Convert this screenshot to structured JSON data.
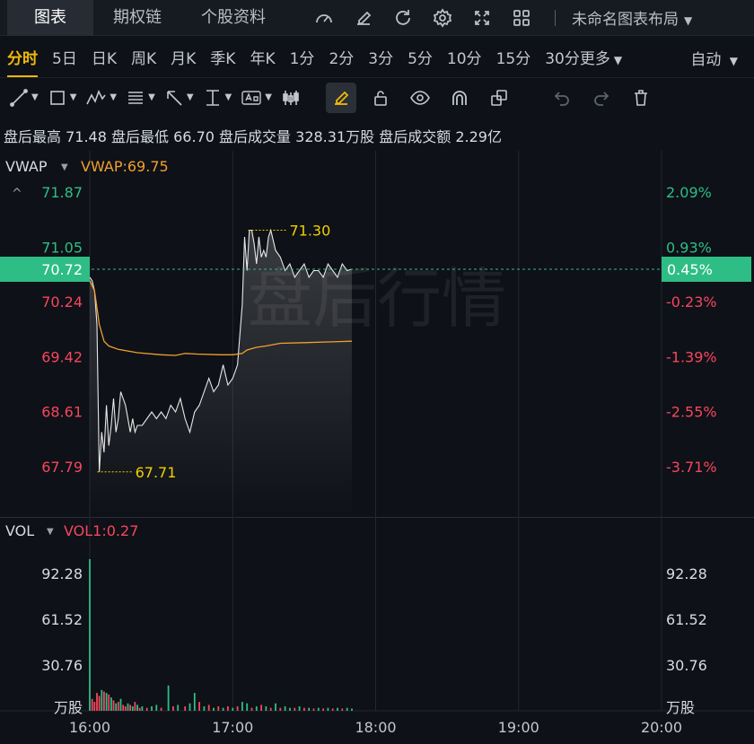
{
  "tabs": [
    "图表",
    "期权链",
    "个股资料"
  ],
  "layout_name": "未命名图表布局",
  "topbar_icons": [
    "gauge-icon",
    "edit-icon",
    "refresh-icon",
    "settings-icon",
    "fullscreen-icon",
    "grid-icon"
  ],
  "periods": [
    "分时",
    "5日",
    "日K",
    "周K",
    "月K",
    "季K",
    "年K",
    "1分",
    "2分",
    "3分",
    "5分",
    "10分",
    "15分",
    "30分更多"
  ],
  "active_period": "分时",
  "auto_label": "自动",
  "tools": [
    "line-tool-icon",
    "rect-tool-icon",
    "pattern-tool-icon",
    "fib-tool-icon",
    "arrow-tool-icon",
    "measure-tool-icon",
    "text-tool-icon",
    "candle-tool-icon",
    "pencil-icon",
    "unlock-icon",
    "eye-icon",
    "magnet-icon",
    "copy-icon",
    "undo-icon",
    "redo-icon",
    "trash-icon"
  ],
  "summary": {
    "high_label": "盘后最高",
    "high": "71.48",
    "low_label": "盘后最低",
    "low": "66.70",
    "vol_label": "盘后成交量",
    "vol": "328.31万股",
    "amt_label": "盘后成交额",
    "amt": "2.29亿"
  },
  "watermark": "盘后行情",
  "colors": {
    "up": "#2ebd85",
    "down": "#f6465d",
    "vwap": "#f0a030",
    "price": "#e8e8e8",
    "annot": "#f0d000",
    "bg": "#0e1117",
    "grid": "#23272f"
  },
  "chart_data": {
    "type": "line",
    "indicator_label": "VWAP",
    "indicator_value": "VWAP:69.75",
    "x_ticks": [
      "16:00",
      "17:00",
      "18:00",
      "19:00",
      "20:00"
    ],
    "x_range": [
      "16:00",
      "20:00"
    ],
    "y_left_ticks": [
      "71.87",
      "71.05",
      "70.24",
      "69.42",
      "68.61",
      "67.79"
    ],
    "y_right_ticks": [
      "2.09%",
      "0.93%",
      "-0.23%",
      "-1.39%",
      "-2.55%",
      "-3.71%"
    ],
    "y_range": [
      67.2,
      72.4
    ],
    "prev_close": 70.4,
    "current_price": "70.72",
    "current_pct": "0.45%",
    "max_label": "71.30",
    "min_label": "67.71",
    "max_point": [
      "17:08",
      71.3
    ],
    "min_point": [
      "16:04",
      67.71
    ],
    "price_series": [
      [
        "16:00",
        70.6
      ],
      [
        "16:01",
        70.55
      ],
      [
        "16:02",
        70.4
      ],
      [
        "16:03",
        69.9
      ],
      [
        "16:04",
        67.71
      ],
      [
        "16:05",
        68.3
      ],
      [
        "16:06",
        68.0
      ],
      [
        "16:07",
        68.7
      ],
      [
        "16:08",
        68.1
      ],
      [
        "16:09",
        68.4
      ],
      [
        "16:10",
        68.8
      ],
      [
        "16:11",
        68.3
      ],
      [
        "16:12",
        68.5
      ],
      [
        "16:13",
        68.9
      ],
      [
        "16:14",
        68.8
      ],
      [
        "16:15",
        68.7
      ],
      [
        "16:16",
        68.5
      ],
      [
        "16:17",
        68.3
      ],
      [
        "16:18",
        68.5
      ],
      [
        "16:19",
        68.3
      ],
      [
        "16:20",
        68.4
      ],
      [
        "16:22",
        68.4
      ],
      [
        "16:24",
        68.5
      ],
      [
        "16:26",
        68.6
      ],
      [
        "16:28",
        68.5
      ],
      [
        "16:30",
        68.6
      ],
      [
        "16:32",
        68.5
      ],
      [
        "16:34",
        68.7
      ],
      [
        "16:36",
        68.6
      ],
      [
        "16:38",
        68.8
      ],
      [
        "16:40",
        68.5
      ],
      [
        "16:42",
        68.3
      ],
      [
        "16:44",
        68.6
      ],
      [
        "16:46",
        68.7
      ],
      [
        "16:48",
        68.9
      ],
      [
        "16:50",
        69.1
      ],
      [
        "16:52",
        68.9
      ],
      [
        "16:54",
        69.0
      ],
      [
        "16:56",
        69.3
      ],
      [
        "16:58",
        69.0
      ],
      [
        "17:00",
        69.1
      ],
      [
        "17:02",
        69.3
      ],
      [
        "17:04",
        70.2
      ],
      [
        "17:05",
        71.2
      ],
      [
        "17:06",
        70.7
      ],
      [
        "17:07",
        71.3
      ],
      [
        "17:08",
        71.3
      ],
      [
        "17:09",
        71.1
      ],
      [
        "17:10",
        70.8
      ],
      [
        "17:11",
        71.2
      ],
      [
        "17:12",
        70.9
      ],
      [
        "17:13",
        71.0
      ],
      [
        "17:14",
        70.9
      ],
      [
        "17:15",
        71.2
      ],
      [
        "17:16",
        71.3
      ],
      [
        "17:18",
        71.0
      ],
      [
        "17:20",
        70.9
      ],
      [
        "17:22",
        70.7
      ],
      [
        "17:24",
        70.8
      ],
      [
        "17:26",
        70.6
      ],
      [
        "17:28",
        70.7
      ],
      [
        "17:30",
        70.8
      ],
      [
        "17:32",
        70.6
      ],
      [
        "17:34",
        70.7
      ],
      [
        "17:36",
        70.7
      ],
      [
        "17:38",
        70.6
      ],
      [
        "17:40",
        70.8
      ],
      [
        "17:42",
        70.7
      ],
      [
        "17:44",
        70.6
      ],
      [
        "17:46",
        70.8
      ],
      [
        "17:48",
        70.7
      ],
      [
        "17:50",
        70.72
      ]
    ],
    "vwap_series": [
      [
        "16:00",
        70.55
      ],
      [
        "16:02",
        70.4
      ],
      [
        "16:04",
        69.9
      ],
      [
        "16:06",
        69.65
      ],
      [
        "16:08",
        69.58
      ],
      [
        "16:12",
        69.53
      ],
      [
        "16:20",
        69.48
      ],
      [
        "16:30",
        69.45
      ],
      [
        "16:36",
        69.44
      ],
      [
        "16:40",
        69.47
      ],
      [
        "16:45",
        69.46
      ],
      [
        "16:55",
        69.45
      ],
      [
        "17:00",
        69.45
      ],
      [
        "17:04",
        69.47
      ],
      [
        "17:06",
        69.52
      ],
      [
        "17:10",
        69.56
      ],
      [
        "17:14",
        69.58
      ],
      [
        "17:20",
        69.62
      ],
      [
        "17:30",
        69.63
      ],
      [
        "17:40",
        69.64
      ],
      [
        "17:50",
        69.65
      ]
    ],
    "volume": {
      "label": "VOL",
      "value_label": "VOL1:0.27",
      "y_ticks": [
        "92.28",
        "61.52",
        "30.76"
      ],
      "unit": "万股",
      "y_range": [
        0,
        105
      ],
      "bars": [
        [
          "16:00",
          102,
          "up"
        ],
        [
          "16:01",
          8,
          "down"
        ],
        [
          "16:02",
          6,
          "down"
        ],
        [
          "16:03",
          12,
          "down"
        ],
        [
          "16:04",
          10,
          "down"
        ],
        [
          "16:05",
          14,
          "up"
        ],
        [
          "16:06",
          13,
          "down"
        ],
        [
          "16:07",
          12,
          "up"
        ],
        [
          "16:08",
          11,
          "down"
        ],
        [
          "16:09",
          9,
          "up"
        ],
        [
          "16:10",
          7,
          "down"
        ],
        [
          "16:11",
          5,
          "up"
        ],
        [
          "16:12",
          6,
          "down"
        ],
        [
          "16:13",
          8,
          "up"
        ],
        [
          "16:14",
          4,
          "down"
        ],
        [
          "16:15",
          3,
          "down"
        ],
        [
          "16:16",
          5,
          "up"
        ],
        [
          "16:17",
          4,
          "down"
        ],
        [
          "16:18",
          3,
          "up"
        ],
        [
          "16:19",
          6,
          "down"
        ],
        [
          "16:20",
          4,
          "up"
        ],
        [
          "16:21",
          2,
          "down"
        ],
        [
          "16:22",
          3,
          "up"
        ],
        [
          "16:24",
          2,
          "down"
        ],
        [
          "16:26",
          3,
          "up"
        ],
        [
          "16:28",
          4,
          "up"
        ],
        [
          "16:30",
          2,
          "down"
        ],
        [
          "16:33",
          17,
          "up"
        ],
        [
          "16:35",
          3,
          "down"
        ],
        [
          "16:37",
          4,
          "up"
        ],
        [
          "16:40",
          3,
          "down"
        ],
        [
          "16:42",
          5,
          "up"
        ],
        [
          "16:44",
          12,
          "up"
        ],
        [
          "16:46",
          6,
          "down"
        ],
        [
          "16:48",
          3,
          "up"
        ],
        [
          "16:50",
          4,
          "down"
        ],
        [
          "16:52",
          2,
          "up"
        ],
        [
          "16:54",
          3,
          "down"
        ],
        [
          "16:56",
          2,
          "up"
        ],
        [
          "16:58",
          3,
          "down"
        ],
        [
          "17:00",
          2,
          "up"
        ],
        [
          "17:02",
          3,
          "down"
        ],
        [
          "17:04",
          6,
          "up"
        ],
        [
          "17:06",
          5,
          "up"
        ],
        [
          "17:08",
          2,
          "down"
        ],
        [
          "17:10",
          3,
          "up"
        ],
        [
          "17:12",
          4,
          "down"
        ],
        [
          "17:14",
          3,
          "up"
        ],
        [
          "17:16",
          2,
          "down"
        ],
        [
          "17:18",
          5,
          "up"
        ],
        [
          "17:20",
          2,
          "down"
        ],
        [
          "17:22",
          3,
          "up"
        ],
        [
          "17:24",
          2,
          "up"
        ],
        [
          "17:26",
          2,
          "down"
        ],
        [
          "17:28",
          3,
          "up"
        ],
        [
          "17:30",
          2,
          "down"
        ],
        [
          "17:32",
          2,
          "up"
        ],
        [
          "17:34",
          1.5,
          "down"
        ],
        [
          "17:36",
          2,
          "up"
        ],
        [
          "17:38",
          1.5,
          "down"
        ],
        [
          "17:40",
          2,
          "up"
        ],
        [
          "17:42",
          1.5,
          "down"
        ],
        [
          "17:44",
          2,
          "up"
        ],
        [
          "17:46",
          1.5,
          "down"
        ],
        [
          "17:48",
          2,
          "up"
        ],
        [
          "17:50",
          1.5,
          "up"
        ]
      ]
    }
  }
}
